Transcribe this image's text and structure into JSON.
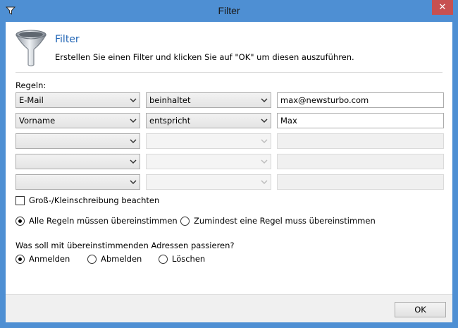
{
  "window": {
    "title": "Filter",
    "close_glyph": "✕"
  },
  "header": {
    "title": "Filter",
    "description": "Erstellen Sie einen Filter und klicken Sie auf \"OK\" um diesen auszuführen.",
    "icon": "funnel-icon"
  },
  "rules": {
    "label": "Regeln:",
    "rows": [
      {
        "field": "E-Mail",
        "operator": "beinhaltet",
        "value": "max@newsturbo.com",
        "enabled": true
      },
      {
        "field": "Vorname",
        "operator": "entspricht",
        "value": "Max",
        "enabled": true
      },
      {
        "field": "",
        "operator": "",
        "value": "",
        "enabled": false
      },
      {
        "field": "",
        "operator": "",
        "value": "",
        "enabled": false
      },
      {
        "field": "",
        "operator": "",
        "value": "",
        "enabled": false
      }
    ]
  },
  "case_sensitive": {
    "label": "Groß-/Kleinschreibung beachten",
    "checked": false
  },
  "match_mode": {
    "options": [
      {
        "label": "Alle Regeln müssen übereinstimmen",
        "selected": true
      },
      {
        "label": "Zumindest eine Regel muss übereinstimmen",
        "selected": false
      }
    ]
  },
  "action": {
    "question": "Was soll mit übereinstimmenden Adressen passieren?",
    "options": [
      {
        "label": "Anmelden",
        "selected": true
      },
      {
        "label": "Abmelden",
        "selected": false
      },
      {
        "label": "Löschen",
        "selected": false
      }
    ]
  },
  "footer": {
    "ok_label": "OK"
  },
  "colors": {
    "accent": "#1e63b4",
    "frame": "#4e8fd3",
    "close": "#c75050"
  }
}
